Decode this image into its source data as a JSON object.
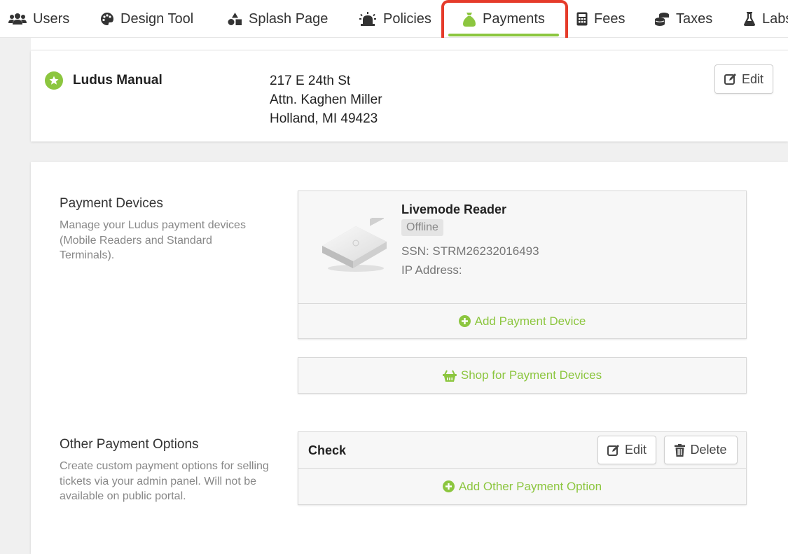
{
  "nav": {
    "tabs": [
      {
        "label": "Users",
        "icon": "users-icon"
      },
      {
        "label": "Design Tool",
        "icon": "palette-icon"
      },
      {
        "label": "Splash Page",
        "icon": "shapes-icon"
      },
      {
        "label": "Policies",
        "icon": "siren-icon"
      },
      {
        "label": "Payments",
        "icon": "money-bag-icon",
        "active": true
      },
      {
        "label": "Fees",
        "icon": "calculator-icon"
      },
      {
        "label": "Taxes",
        "icon": "coins-icon"
      },
      {
        "label": "Labs",
        "icon": "flask-icon"
      }
    ]
  },
  "org": {
    "name": "Ludus Manual",
    "address_line1": "217 E 24th St",
    "address_line2": "Attn. Kaghen Miller",
    "address_line3": "Holland, MI 49423",
    "edit_label": "Edit"
  },
  "payment_devices": {
    "title": "Payment Devices",
    "description": "Manage your Ludus payment devices (Mobile Readers and Standard Terminals).",
    "device": {
      "name": "Livemode Reader",
      "status": "Offline",
      "ssn": "SSN: STRM26232016493",
      "ip": "IP Address:"
    },
    "add_label": "Add Payment Device",
    "shop_label": "Shop for Payment Devices"
  },
  "other_options": {
    "title": "Other Payment Options",
    "description": "Create custom payment options for selling tickets via your admin panel. Will not be available on public portal.",
    "option_name": "Check",
    "edit_label": "Edit",
    "delete_label": "Delete",
    "add_label": "Add Other Payment Option"
  },
  "colors": {
    "accent": "#8cc63f",
    "highlight": "#e53b2a"
  }
}
